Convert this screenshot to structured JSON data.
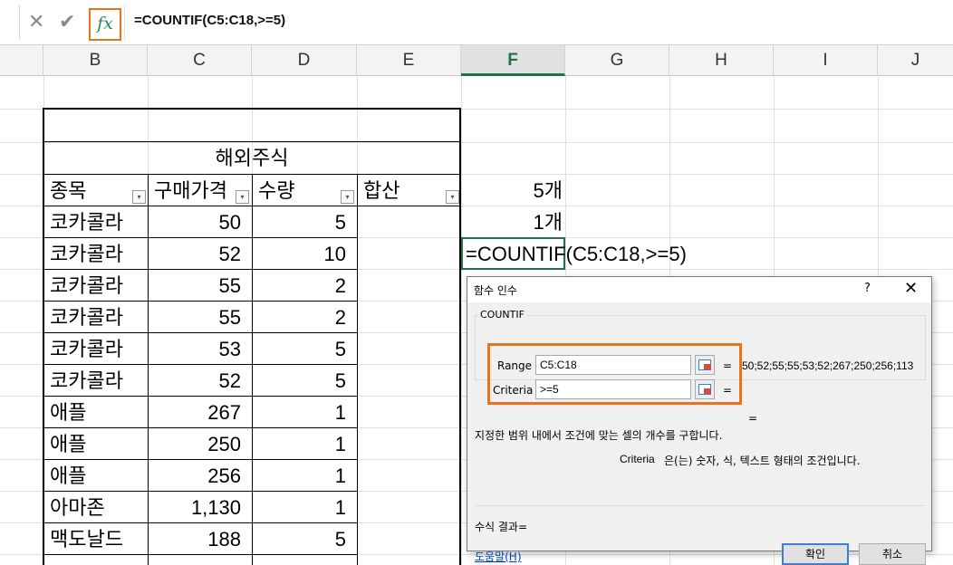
{
  "formula_bar": {
    "cancel_icon": "✕",
    "enter_icon": "✔",
    "fx_label": "fx",
    "formula": "=COUNTIF(C5:C18,>=5)"
  },
  "columns": [
    {
      "label": "B",
      "selected": false
    },
    {
      "label": "C",
      "selected": false
    },
    {
      "label": "D",
      "selected": false
    },
    {
      "label": "E",
      "selected": false
    },
    {
      "label": "F",
      "selected": true
    },
    {
      "label": "G",
      "selected": false
    },
    {
      "label": "H",
      "selected": false
    },
    {
      "label": "I",
      "selected": false
    },
    {
      "label": "J",
      "selected": false
    }
  ],
  "table": {
    "title": "해외주식",
    "headers": [
      "종목",
      "구매가격",
      "수량",
      "합산"
    ],
    "rows": [
      [
        "코카콜라",
        "50",
        "5"
      ],
      [
        "코카콜라",
        "52",
        "10"
      ],
      [
        "코카콜라",
        "55",
        "2"
      ],
      [
        "코카콜라",
        "55",
        "2"
      ],
      [
        "코카콜라",
        "53",
        "5"
      ],
      [
        "코카콜라",
        "52",
        "5"
      ],
      [
        "애플",
        "267",
        "1"
      ],
      [
        "애플",
        "250",
        "1"
      ],
      [
        "애플",
        "256",
        "1"
      ],
      [
        "아마존",
        "1,130",
        "1"
      ],
      [
        "맥도날드",
        "188",
        "5"
      ]
    ]
  },
  "side_cells": {
    "f1": "5개",
    "f2": "1개",
    "f3": "=COUNTIF(C5:C18,>=5)"
  },
  "dialog": {
    "title": "함수 인수",
    "help_icon": "?",
    "close_icon": "✕",
    "function_name": "COUNTIF",
    "args": [
      {
        "label": "Range",
        "value": "C5:C18",
        "result": "50;52;55;55;53;52;267;250;256;113"
      },
      {
        "label": "Criteria",
        "value": ">=5",
        "result": ""
      }
    ],
    "equals": "=",
    "description": "지정한 범위 내에서 조건에 맞는 셀의 개수를 구합니다.",
    "criteria_name": "Criteria",
    "criteria_desc": "은(는) 숫자, 식, 텍스트 형태의 조건입니다.",
    "result_label": "수식 결과=",
    "help_link": "도움말(H)",
    "ok_label": "확인",
    "cancel_label": "취소"
  },
  "colors": {
    "accent_highlight": "#e8731a",
    "excel_green": "#217346"
  }
}
